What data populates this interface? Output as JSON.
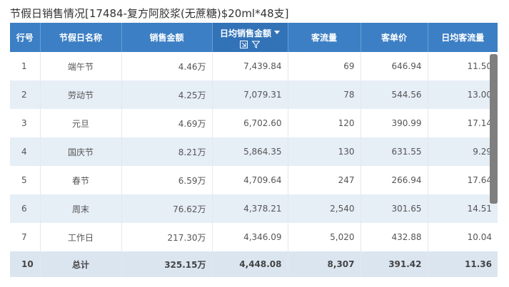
{
  "title": "节假日销售情况[17484-复方阿胶浆(无蔗糖)$20ml*48支]",
  "columns": {
    "index": "行号",
    "holiday": "节假日名称",
    "sales": "销售金额",
    "daily_sales": "日均销售金额",
    "traffic": "客流量",
    "avg_ticket": "客单价",
    "daily_traffic": "日均客流量"
  },
  "rows": [
    {
      "index": "1",
      "holiday": "端午节",
      "sales": "4.46万",
      "daily_sales": "7,439.84",
      "traffic": "69",
      "avg_ticket": "646.94",
      "daily_traffic": "11.50"
    },
    {
      "index": "2",
      "holiday": "劳动节",
      "sales": "4.25万",
      "daily_sales": "7,079.31",
      "traffic": "78",
      "avg_ticket": "544.56",
      "daily_traffic": "13.00"
    },
    {
      "index": "3",
      "holiday": "元旦",
      "sales": "4.69万",
      "daily_sales": "6,702.60",
      "traffic": "120",
      "avg_ticket": "390.99",
      "daily_traffic": "17.14"
    },
    {
      "index": "4",
      "holiday": "国庆节",
      "sales": "8.21万",
      "daily_sales": "5,864.35",
      "traffic": "130",
      "avg_ticket": "631.55",
      "daily_traffic": "9.29"
    },
    {
      "index": "5",
      "holiday": "春节",
      "sales": "6.59万",
      "daily_sales": "4,709.64",
      "traffic": "247",
      "avg_ticket": "266.94",
      "daily_traffic": "17.64"
    },
    {
      "index": "6",
      "holiday": "周末",
      "sales": "76.62万",
      "daily_sales": "4,378.21",
      "traffic": "2,540",
      "avg_ticket": "301.65",
      "daily_traffic": "14.51"
    },
    {
      "index": "7",
      "holiday": "工作日",
      "sales": "217.30万",
      "daily_sales": "4,346.09",
      "traffic": "5,020",
      "avg_ticket": "432.88",
      "daily_traffic": "10.04"
    }
  ],
  "total": {
    "index": "10",
    "holiday": "总计",
    "sales": "325.15万",
    "daily_sales": "4,448.08",
    "traffic": "8,307",
    "avg_ticket": "391.42",
    "daily_traffic": "11.36"
  },
  "colors": {
    "header": "#3c7fc4",
    "row_alt": "#e6eef6",
    "total": "#dbe5f0"
  },
  "icons": {
    "sort": "caret-down-icon",
    "reset": "reset-sort-icon",
    "filter": "filter-icon"
  }
}
